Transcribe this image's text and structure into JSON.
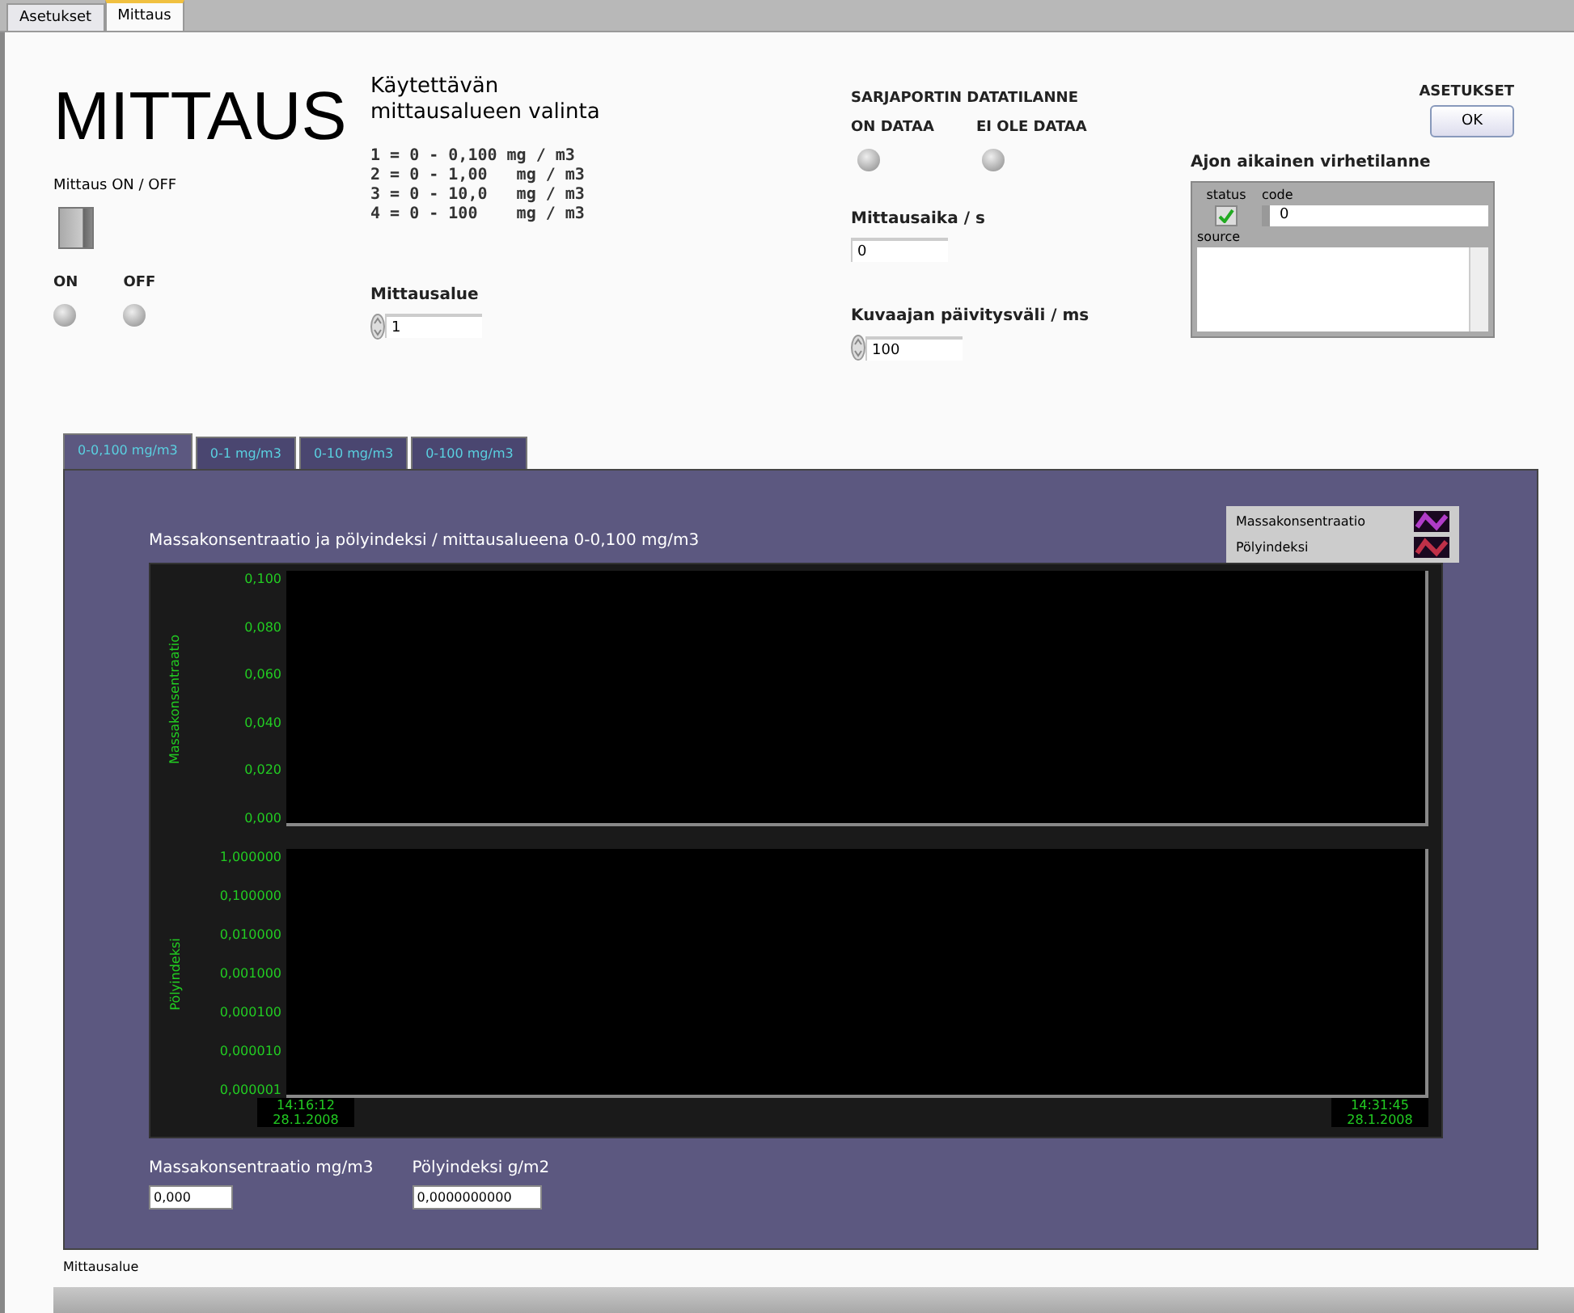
{
  "window_tabs": [
    {
      "label": "Asetukset",
      "selected": false
    },
    {
      "label": "Mittaus",
      "selected": true
    }
  ],
  "title": "MITTAUS",
  "power": {
    "label": "Mittaus ON / OFF",
    "on": false
  },
  "lamps": [
    {
      "label": "ON",
      "lit": false
    },
    {
      "label": "OFF",
      "lit": false
    }
  ],
  "range_select": {
    "heading": "Käytettävän mittausalueen valinta",
    "options": [
      "1 = 0 - 0,100 mg / m3",
      "2 = 0 - 1,00   mg / m3",
      "3 = 0 - 10,0   mg / m3",
      "4 = 0 - 100    mg / m3"
    ],
    "label": "Mittausalue",
    "value": "1"
  },
  "serial": {
    "heading": "SARJAPORTIN DATATILANNE",
    "lamps": [
      {
        "label": "ON DATAA",
        "lit": false
      },
      {
        "label": "EI OLE DATAA",
        "lit": false
      }
    ]
  },
  "fields": [
    {
      "label": "Mittausaika / s",
      "value": "0",
      "spinner": false
    },
    {
      "label": "Kuvaajan päivitysväli / ms",
      "value": "100",
      "spinner": true
    }
  ],
  "settings": {
    "heading": "ASETUKSET",
    "button": "OK"
  },
  "error": {
    "heading": "Ajon aikainen virhetilanne",
    "status_label": "status",
    "status_ok": true,
    "code_label": "code",
    "code": "0",
    "source_label": "source"
  },
  "range_tabs": [
    {
      "label": "0-0,100 mg/m3",
      "selected": true
    },
    {
      "label": "0-1 mg/m3",
      "selected": false
    },
    {
      "label": "0-10 mg/m3",
      "selected": false
    },
    {
      "label": "0-100 mg/m3",
      "selected": false
    }
  ],
  "graph": {
    "title": "Massakonsentraatio ja pölyindeksi / mittausalueena 0-0,100 mg/m3",
    "legend": [
      {
        "name": "Massakonsentraatio",
        "color": "#b03cc8"
      },
      {
        "name": "Pölyindeksi",
        "color": "#c03048"
      }
    ],
    "plots": [
      {
        "axis_title": "Massakonsentraatio",
        "axis_labels": [
          "0,100",
          "0,080",
          "0,060",
          "0,040",
          "0,020",
          "0,000"
        ]
      },
      {
        "axis_title": "Pölyindeksi",
        "axis_labels": [
          "1,000000",
          "0,100000",
          "0,010000",
          "0,001000",
          "0,000100",
          "0,000010",
          "0,000001"
        ],
        "time_labels": [
          "14:16:12 28.1.2008",
          "14:31:45 28.1.2008"
        ]
      }
    ]
  },
  "readouts": [
    {
      "label": "Massakonsentraatio mg/m3",
      "value": "0,000"
    },
    {
      "label": "Pölyindeksi g/m2",
      "value": "0,0000000000"
    }
  ],
  "footer_label": "Mittausalue"
}
